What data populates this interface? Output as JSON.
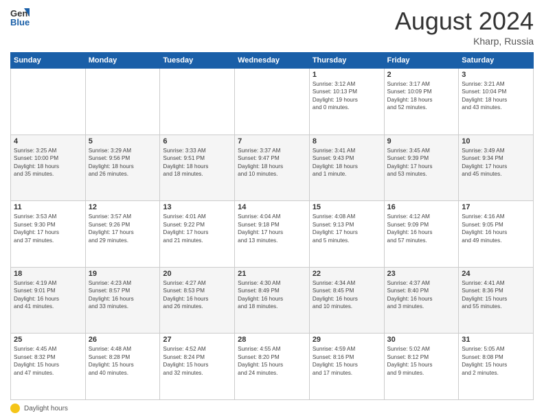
{
  "header": {
    "logo_line1": "General",
    "logo_line2": "Blue",
    "month_year": "August 2024",
    "location": "Kharp, Russia"
  },
  "days_of_week": [
    "Sunday",
    "Monday",
    "Tuesday",
    "Wednesday",
    "Thursday",
    "Friday",
    "Saturday"
  ],
  "weeks": [
    [
      {
        "day": "",
        "info": ""
      },
      {
        "day": "",
        "info": ""
      },
      {
        "day": "",
        "info": ""
      },
      {
        "day": "",
        "info": ""
      },
      {
        "day": "1",
        "info": "Sunrise: 3:12 AM\nSunset: 10:13 PM\nDaylight: 19 hours\nand 0 minutes."
      },
      {
        "day": "2",
        "info": "Sunrise: 3:17 AM\nSunset: 10:09 PM\nDaylight: 18 hours\nand 52 minutes."
      },
      {
        "day": "3",
        "info": "Sunrise: 3:21 AM\nSunset: 10:04 PM\nDaylight: 18 hours\nand 43 minutes."
      }
    ],
    [
      {
        "day": "4",
        "info": "Sunrise: 3:25 AM\nSunset: 10:00 PM\nDaylight: 18 hours\nand 35 minutes."
      },
      {
        "day": "5",
        "info": "Sunrise: 3:29 AM\nSunset: 9:56 PM\nDaylight: 18 hours\nand 26 minutes."
      },
      {
        "day": "6",
        "info": "Sunrise: 3:33 AM\nSunset: 9:51 PM\nDaylight: 18 hours\nand 18 minutes."
      },
      {
        "day": "7",
        "info": "Sunrise: 3:37 AM\nSunset: 9:47 PM\nDaylight: 18 hours\nand 10 minutes."
      },
      {
        "day": "8",
        "info": "Sunrise: 3:41 AM\nSunset: 9:43 PM\nDaylight: 18 hours\nand 1 minute."
      },
      {
        "day": "9",
        "info": "Sunrise: 3:45 AM\nSunset: 9:39 PM\nDaylight: 17 hours\nand 53 minutes."
      },
      {
        "day": "10",
        "info": "Sunrise: 3:49 AM\nSunset: 9:34 PM\nDaylight: 17 hours\nand 45 minutes."
      }
    ],
    [
      {
        "day": "11",
        "info": "Sunrise: 3:53 AM\nSunset: 9:30 PM\nDaylight: 17 hours\nand 37 minutes."
      },
      {
        "day": "12",
        "info": "Sunrise: 3:57 AM\nSunset: 9:26 PM\nDaylight: 17 hours\nand 29 minutes."
      },
      {
        "day": "13",
        "info": "Sunrise: 4:01 AM\nSunset: 9:22 PM\nDaylight: 17 hours\nand 21 minutes."
      },
      {
        "day": "14",
        "info": "Sunrise: 4:04 AM\nSunset: 9:18 PM\nDaylight: 17 hours\nand 13 minutes."
      },
      {
        "day": "15",
        "info": "Sunrise: 4:08 AM\nSunset: 9:13 PM\nDaylight: 17 hours\nand 5 minutes."
      },
      {
        "day": "16",
        "info": "Sunrise: 4:12 AM\nSunset: 9:09 PM\nDaylight: 16 hours\nand 57 minutes."
      },
      {
        "day": "17",
        "info": "Sunrise: 4:16 AM\nSunset: 9:05 PM\nDaylight: 16 hours\nand 49 minutes."
      }
    ],
    [
      {
        "day": "18",
        "info": "Sunrise: 4:19 AM\nSunset: 9:01 PM\nDaylight: 16 hours\nand 41 minutes."
      },
      {
        "day": "19",
        "info": "Sunrise: 4:23 AM\nSunset: 8:57 PM\nDaylight: 16 hours\nand 33 minutes."
      },
      {
        "day": "20",
        "info": "Sunrise: 4:27 AM\nSunset: 8:53 PM\nDaylight: 16 hours\nand 26 minutes."
      },
      {
        "day": "21",
        "info": "Sunrise: 4:30 AM\nSunset: 8:49 PM\nDaylight: 16 hours\nand 18 minutes."
      },
      {
        "day": "22",
        "info": "Sunrise: 4:34 AM\nSunset: 8:45 PM\nDaylight: 16 hours\nand 10 minutes."
      },
      {
        "day": "23",
        "info": "Sunrise: 4:37 AM\nSunset: 8:40 PM\nDaylight: 16 hours\nand 3 minutes."
      },
      {
        "day": "24",
        "info": "Sunrise: 4:41 AM\nSunset: 8:36 PM\nDaylight: 15 hours\nand 55 minutes."
      }
    ],
    [
      {
        "day": "25",
        "info": "Sunrise: 4:45 AM\nSunset: 8:32 PM\nDaylight: 15 hours\nand 47 minutes."
      },
      {
        "day": "26",
        "info": "Sunrise: 4:48 AM\nSunset: 8:28 PM\nDaylight: 15 hours\nand 40 minutes."
      },
      {
        "day": "27",
        "info": "Sunrise: 4:52 AM\nSunset: 8:24 PM\nDaylight: 15 hours\nand 32 minutes."
      },
      {
        "day": "28",
        "info": "Sunrise: 4:55 AM\nSunset: 8:20 PM\nDaylight: 15 hours\nand 24 minutes."
      },
      {
        "day": "29",
        "info": "Sunrise: 4:59 AM\nSunset: 8:16 PM\nDaylight: 15 hours\nand 17 minutes."
      },
      {
        "day": "30",
        "info": "Sunrise: 5:02 AM\nSunset: 8:12 PM\nDaylight: 15 hours\nand 9 minutes."
      },
      {
        "day": "31",
        "info": "Sunrise: 5:05 AM\nSunset: 8:08 PM\nDaylight: 15 hours\nand 2 minutes."
      }
    ]
  ],
  "footer": {
    "daylight_label": "Daylight hours"
  }
}
